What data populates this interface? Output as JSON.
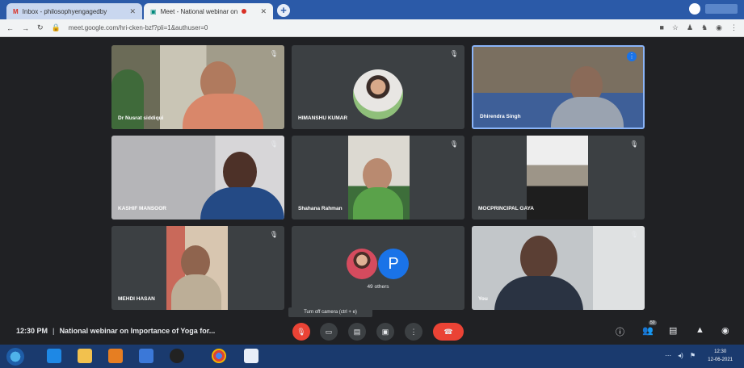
{
  "browser": {
    "tabs": [
      {
        "label": "Inbox - philosophyengagedby",
        "icon": "gmail-icon",
        "active": false
      },
      {
        "label": "Meet - National webinar on",
        "icon": "meet-icon",
        "active": true
      }
    ],
    "url": "meet.google.com/hri-cken-bzf?pli=1&authuser=0"
  },
  "participants": [
    {
      "name": "Dr Nusrat siddiqui",
      "tile": "video"
    },
    {
      "name": "HIMANSHU KUMAR",
      "tile": "avatar"
    },
    {
      "name": "Dhirendra Singh",
      "tile": "video"
    },
    {
      "name": "KASHIF MANSOOR",
      "tile": "video"
    },
    {
      "name": "Shahana Rahman",
      "tile": "video"
    },
    {
      "name": "MOCPRINCIPAL GAYA",
      "tile": "video"
    },
    {
      "name": "MEHDI HASAN",
      "tile": "video"
    },
    {
      "name": "",
      "tile": "others"
    },
    {
      "name": "You",
      "tile": "video"
    }
  ],
  "others": {
    "letter": "P",
    "label": "49 others"
  },
  "tooltip": "Turn off camera (ctrl + e)",
  "meeting": {
    "time": "12:30 PM",
    "separator": "|",
    "title": "National webinar on Importance of Yoga for..."
  },
  "controls": [
    "mic-icon",
    "camera-icon",
    "captions-icon",
    "present-icon",
    "more-icon",
    "hangup-icon"
  ],
  "right_controls": [
    {
      "icon": "info-icon"
    },
    {
      "icon": "people-icon",
      "badge": "50"
    },
    {
      "icon": "chat-icon"
    },
    {
      "icon": "activities-icon"
    },
    {
      "icon": "shield-icon"
    }
  ],
  "taskbar": {
    "time": "12:30",
    "date": "12-06-2021"
  },
  "colors": {
    "stage": "#202124",
    "tile": "#3c4043",
    "hangup": "#ea4335",
    "taskbar": "#1a3a6e"
  }
}
